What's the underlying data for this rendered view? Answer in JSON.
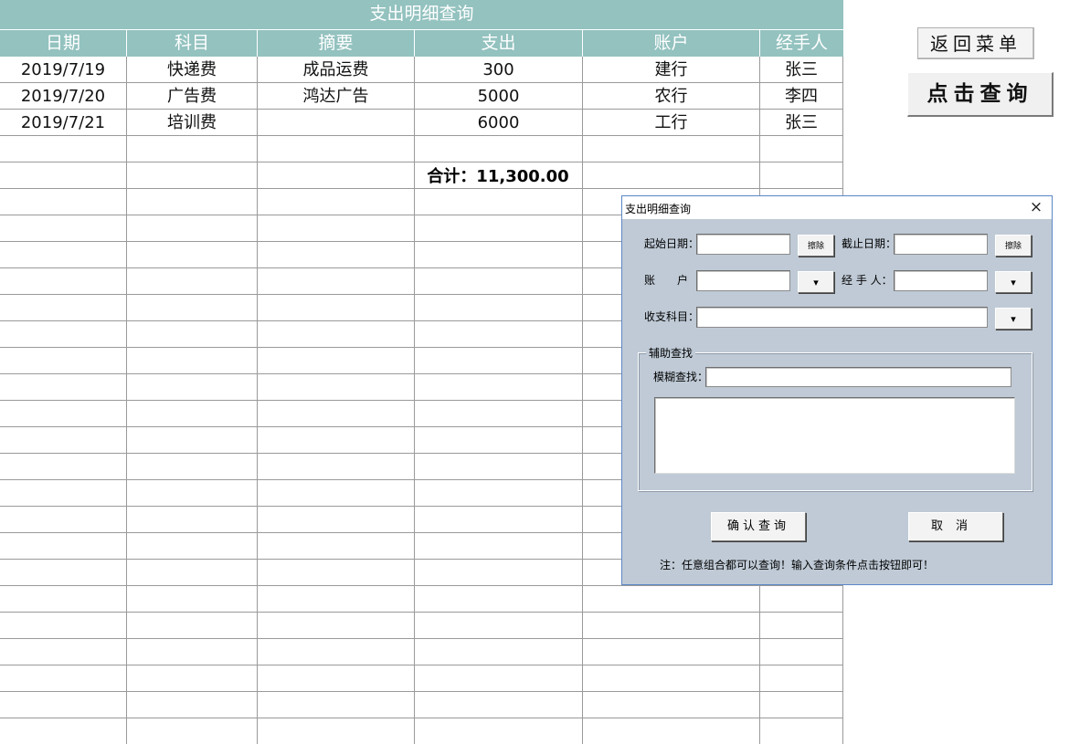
{
  "sheet": {
    "title": "支出明细查询",
    "columns": [
      "日期",
      "科目",
      "摘要",
      "支出",
      "账户",
      "经手人"
    ],
    "rows": [
      [
        "2019/7/19",
        "快递费",
        "成品运费",
        "300",
        "建行",
        "张三"
      ],
      [
        "2019/7/20",
        "广告费",
        "鸿达广告",
        "5000",
        "农行",
        "李四"
      ],
      [
        "2019/7/21",
        "培训费",
        "",
        "6000",
        "工行",
        "张三"
      ]
    ],
    "total_label": "合计：11,300.00",
    "header_color": "#93c2bf"
  },
  "buttons": {
    "menu": "返回菜单",
    "query": "点击查询"
  },
  "dialog": {
    "title": "支出明细查询",
    "close_icon": "×",
    "start_date_label": "起始日期：",
    "end_date_label": "截止日期：",
    "account_label": "账　　户",
    "handler_label": "经 手 人：",
    "category_label": "收支科目：",
    "clear_label": "擦除",
    "dropdown_label": "▾",
    "aux_group_label": "辅助查找",
    "fuzzy_label": "模糊查找：",
    "confirm_label": "确认查询",
    "cancel_label": "取消",
    "note": "注：任意组合都可以查询！输入查询条件点击按钮即可！",
    "start_date_value": "",
    "end_date_value": "",
    "account_value": "",
    "handler_value": "",
    "category_value": "",
    "fuzzy_value": ""
  }
}
